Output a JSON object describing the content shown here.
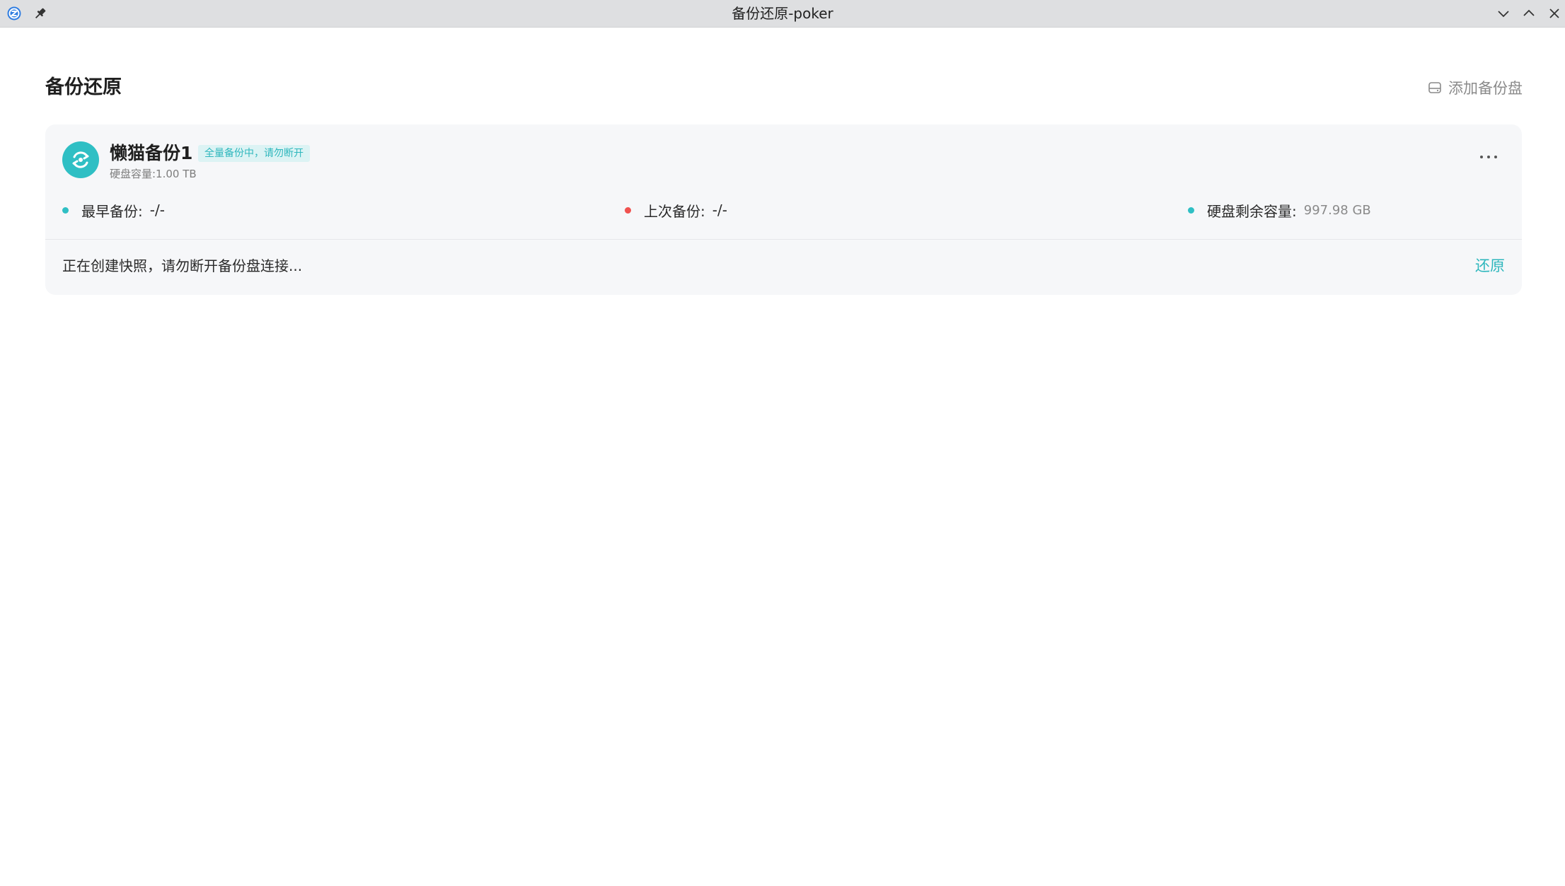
{
  "window": {
    "title": "备份还原-poker",
    "app_icon": "app-logo-icon",
    "pin_icon": "pin-icon",
    "controls": [
      "chevron-down-icon",
      "chevron-up-icon",
      "close-icon"
    ]
  },
  "page": {
    "title": "备份还原",
    "add_disk_label": "添加备份盘",
    "add_disk_icon": "disk-icon"
  },
  "card": {
    "name": "懒猫备份1",
    "status_badge": "全量备份中，请勿断开",
    "capacity": "硬盘容量:1.00 TB",
    "avatar_icon": "sync-icon",
    "more_icon": "more-horizontal-icon",
    "stats": [
      {
        "label": "最早备份:",
        "value": "-/-",
        "dot_color": "#2fbfc4"
      },
      {
        "label": "上次备份:",
        "value": "-/-",
        "dot_color": "#f0524f"
      },
      {
        "label": "硬盘剩余容量:",
        "value": "997.98 GB",
        "dot_color": "#2fbfc4"
      }
    ],
    "message": "正在创建快照，请勿断开备份盘连接...",
    "restore_label": "还原"
  },
  "colors": {
    "accent": "#2fbfc4",
    "warning_dot": "#f0524f",
    "titlebar_bg": "#dedfe1",
    "card_bg": "#f6f7f9"
  }
}
